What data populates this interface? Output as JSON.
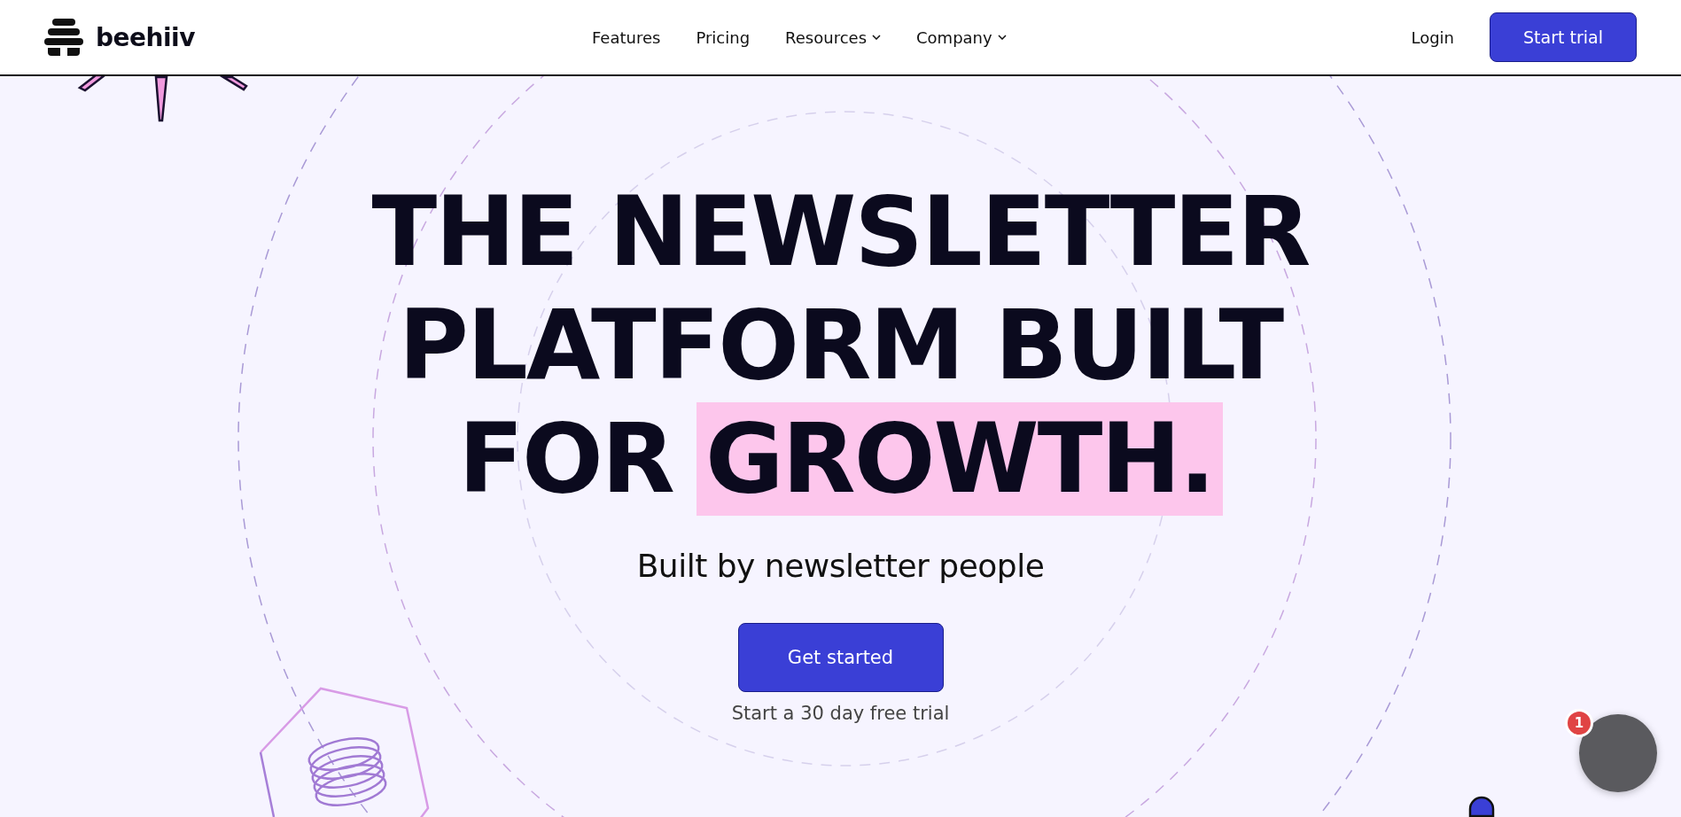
{
  "header": {
    "logo": "beehiiv",
    "nav": [
      {
        "label": "Features",
        "has_dropdown": false
      },
      {
        "label": "Pricing",
        "has_dropdown": false
      },
      {
        "label": "Resources",
        "has_dropdown": true
      },
      {
        "label": "Company",
        "has_dropdown": true
      }
    ],
    "login": "Login",
    "cta": "Start trial"
  },
  "hero": {
    "headline_lines": [
      "THE NEWSLETTER",
      "PLATFORM BUILT"
    ],
    "headline_last": "FOR",
    "headline_highlight": "GROWTH.",
    "subtitle": "Built by newsletter people",
    "button": "Get started",
    "note": "Start a 30 day free trial"
  },
  "chat": {
    "badge": "1"
  }
}
